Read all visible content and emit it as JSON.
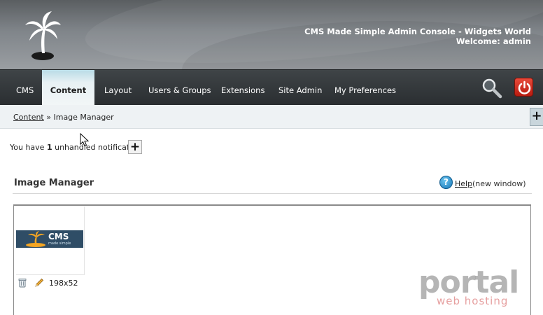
{
  "header": {
    "title": "CMS Made Simple Admin Console - Widgets World",
    "welcome": "Welcome: admin"
  },
  "nav": {
    "items": [
      {
        "label": "CMS",
        "active": false
      },
      {
        "label": "Content",
        "active": true
      },
      {
        "label": "Layout",
        "active": false
      },
      {
        "label": "Users & Groups",
        "active": false
      },
      {
        "label": "Extensions",
        "active": false
      },
      {
        "label": "Site Admin",
        "active": false
      },
      {
        "label": "My Preferences",
        "active": false
      }
    ],
    "search_icon": "magnifier-icon",
    "logout_icon": "power-icon"
  },
  "breadcrumb": {
    "parent": "Content",
    "separator": "»",
    "current": "Image Manager"
  },
  "notification": {
    "prefix": "You have",
    "count": "1",
    "suffix": "unhandled notification",
    "expand_label": "+"
  },
  "page": {
    "title": "Image Manager",
    "help_link": "Help",
    "help_extra": "(new window)"
  },
  "images": [
    {
      "thumb_text": "CMS",
      "thumb_tagline": "made simple",
      "dimensions": "198x52"
    }
  ],
  "side_expand_label": "+",
  "watermark": {
    "line1": "portal",
    "line2": "web hosting"
  },
  "colors": {
    "nav_bg": "#2f3437",
    "active_tab": "#e8f1f4",
    "logout": "#d03426",
    "thumb_bg": "#2f4d66",
    "accent_orange": "#f5a623"
  }
}
